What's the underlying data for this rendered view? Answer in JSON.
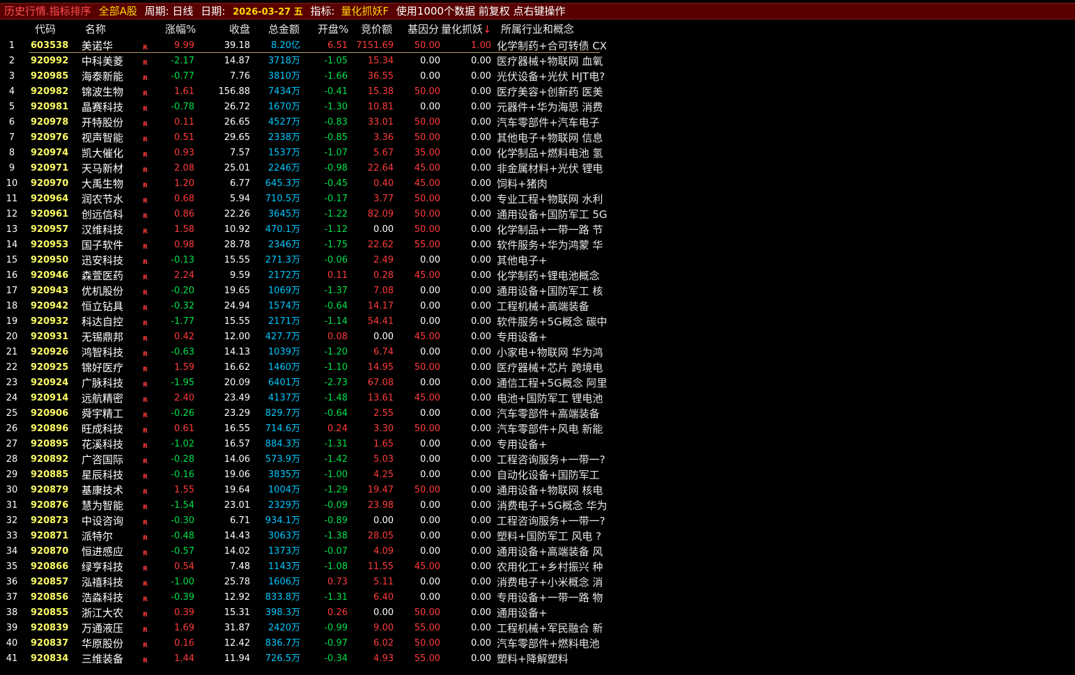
{
  "titlebar": {
    "module": "历史行情.指标排序",
    "scope": "全部A股",
    "period": "周期: 日线",
    "date_label": "日期:",
    "date": "2026-03-27 五",
    "indicator_label": "指标:",
    "indicator": "量化抓妖F",
    "info": "使用1000个数据 前复权 点右键操作"
  },
  "columns": {
    "code": "代码",
    "name": "名称",
    "chg": "涨幅%",
    "close": "收盘",
    "amount": "总金额",
    "open": "开盘%",
    "bid": "竞价额",
    "base": "基因分",
    "indicator": "量化抓妖",
    "sort_arrow": "↓",
    "concept": "所属行业和概念"
  },
  "colors": {
    "background": "#000000",
    "titlebar": "#590000",
    "up": "#ff3b3b",
    "down": "#00e04a",
    "code": "#ffff66",
    "amount": "#00c8ff"
  },
  "rows": [
    {
      "idx": "1",
      "code": "603538",
      "name": "美诺华",
      "r": "R",
      "chg": "9.99",
      "close": "39.18",
      "amount": "8.20亿",
      "open": "6.51",
      "bid": "7151.69",
      "base": "50.00",
      "ind": "1.00",
      "concept": "化学制药+合可转债 CX"
    },
    {
      "idx": "2",
      "code": "920992",
      "name": "中科美菱",
      "r": "R",
      "chg": "-2.17",
      "close": "14.87",
      "amount": "3718万",
      "open": "-1.05",
      "bid": "15.34",
      "base": "0.00",
      "ind": "0.00",
      "concept": "医疗器械+物联网 血氧"
    },
    {
      "idx": "3",
      "code": "920985",
      "name": "海泰新能",
      "r": "R",
      "chg": "-0.77",
      "close": "7.76",
      "amount": "3810万",
      "open": "-1.66",
      "bid": "36.55",
      "base": "0.00",
      "ind": "0.00",
      "concept": "光伏设备+光伏 HJT电?"
    },
    {
      "idx": "4",
      "code": "920982",
      "name": "锦波生物",
      "r": "R",
      "chg": "1.61",
      "close": "156.88",
      "amount": "7434万",
      "open": "-0.41",
      "bid": "15.38",
      "base": "50.00",
      "ind": "0.00",
      "concept": "医疗美容+创新药 医美"
    },
    {
      "idx": "5",
      "code": "920981",
      "name": "晶赛科技",
      "r": "R",
      "chg": "-0.78",
      "close": "26.72",
      "amount": "1670万",
      "open": "-1.30",
      "bid": "10.81",
      "base": "0.00",
      "ind": "0.00",
      "concept": "元器件+华为海思 消费"
    },
    {
      "idx": "6",
      "code": "920978",
      "name": "开特股份",
      "r": "R",
      "chg": "0.11",
      "close": "26.65",
      "amount": "4527万",
      "open": "-0.83",
      "bid": "33.01",
      "base": "50.00",
      "ind": "0.00",
      "concept": "汽车零部件+汽车电子"
    },
    {
      "idx": "7",
      "code": "920976",
      "name": "视声智能",
      "r": "R",
      "chg": "0.51",
      "close": "29.65",
      "amount": "2338万",
      "open": "-0.85",
      "bid": "3.36",
      "base": "50.00",
      "ind": "0.00",
      "concept": "其他电子+物联网 信息"
    },
    {
      "idx": "8",
      "code": "920974",
      "name": "凯大催化",
      "r": "R",
      "chg": "0.93",
      "close": "7.57",
      "amount": "1537万",
      "open": "-1.07",
      "bid": "5.67",
      "base": "35.00",
      "ind": "0.00",
      "concept": "化学制品+燃料电池 氢"
    },
    {
      "idx": "9",
      "code": "920971",
      "name": "天马新材",
      "r": "R",
      "chg": "2.08",
      "close": "25.01",
      "amount": "2246万",
      "open": "-0.98",
      "bid": "22.64",
      "base": "45.00",
      "ind": "0.00",
      "concept": "非金属材料+光伏 锂电"
    },
    {
      "idx": "10",
      "code": "920970",
      "name": "大禹生物",
      "r": "R",
      "chg": "1.20",
      "close": "6.77",
      "amount": "645.3万",
      "open": "-0.45",
      "bid": "0.40",
      "base": "45.00",
      "ind": "0.00",
      "concept": "饲料+猪肉"
    },
    {
      "idx": "11",
      "code": "920964",
      "name": "润农节水",
      "r": "R",
      "chg": "0.68",
      "close": "5.94",
      "amount": "710.5万",
      "open": "-0.17",
      "bid": "3.77",
      "base": "50.00",
      "ind": "0.00",
      "concept": "专业工程+物联网 水利"
    },
    {
      "idx": "12",
      "code": "920961",
      "name": "创远信科",
      "r": "R",
      "chg": "0.86",
      "close": "22.26",
      "amount": "3645万",
      "open": "-1.22",
      "bid": "82.09",
      "base": "50.00",
      "ind": "0.00",
      "concept": "通用设备+国防军工 5G"
    },
    {
      "idx": "13",
      "code": "920957",
      "name": "汉维科技",
      "r": "R",
      "chg": "1.58",
      "close": "10.92",
      "amount": "470.1万",
      "open": "-1.12",
      "bid": "0.00",
      "base": "50.00",
      "ind": "0.00",
      "concept": "化学制品+一带一路 节"
    },
    {
      "idx": "14",
      "code": "920953",
      "name": "国子软件",
      "r": "R",
      "chg": "0.98",
      "close": "28.78",
      "amount": "2346万",
      "open": "-1.75",
      "bid": "22.62",
      "base": "55.00",
      "ind": "0.00",
      "concept": "软件服务+华为鸿蒙 华"
    },
    {
      "idx": "15",
      "code": "920950",
      "name": "迅安科技",
      "r": "R",
      "chg": "-0.13",
      "close": "15.55",
      "amount": "271.3万",
      "open": "-0.06",
      "bid": "2.49",
      "base": "0.00",
      "ind": "0.00",
      "concept": "其他电子+"
    },
    {
      "idx": "16",
      "code": "920946",
      "name": "森萱医药",
      "r": "R",
      "chg": "2.24",
      "close": "9.59",
      "amount": "2172万",
      "open": "0.11",
      "bid": "0.28",
      "base": "45.00",
      "ind": "0.00",
      "concept": "化学制药+锂电池概念"
    },
    {
      "idx": "17",
      "code": "920943",
      "name": "优机股份",
      "r": "R",
      "chg": "-0.20",
      "close": "19.65",
      "amount": "1069万",
      "open": "-1.37",
      "bid": "7.08",
      "base": "0.00",
      "ind": "0.00",
      "concept": "通用设备+国防军工 核"
    },
    {
      "idx": "18",
      "code": "920942",
      "name": "恒立钻具",
      "r": "R",
      "chg": "-0.32",
      "close": "24.94",
      "amount": "1574万",
      "open": "-0.64",
      "bid": "14.17",
      "base": "0.00",
      "ind": "0.00",
      "concept": "工程机械+高端装备"
    },
    {
      "idx": "19",
      "code": "920932",
      "name": "科达自控",
      "r": "R",
      "chg": "-1.77",
      "close": "15.55",
      "amount": "2171万",
      "open": "-1.14",
      "bid": "54.41",
      "base": "0.00",
      "ind": "0.00",
      "concept": "软件服务+5G概念 碳中"
    },
    {
      "idx": "20",
      "code": "920931",
      "name": "无锡鼎邦",
      "r": "R",
      "chg": "0.42",
      "close": "12.00",
      "amount": "427.7万",
      "open": "0.08",
      "bid": "0.00",
      "base": "45.00",
      "ind": "0.00",
      "concept": "专用设备+"
    },
    {
      "idx": "21",
      "code": "920926",
      "name": "鸿智科技",
      "r": "R",
      "chg": "-0.63",
      "close": "14.13",
      "amount": "1039万",
      "open": "-1.20",
      "bid": "6.74",
      "base": "0.00",
      "ind": "0.00",
      "concept": "小家电+物联网 华为鸿"
    },
    {
      "idx": "22",
      "code": "920925",
      "name": "锦好医疗",
      "r": "R",
      "chg": "1.59",
      "close": "16.62",
      "amount": "1460万",
      "open": "-1.10",
      "bid": "14.95",
      "base": "50.00",
      "ind": "0.00",
      "concept": "医疗器械+芯片 跨境电"
    },
    {
      "idx": "23",
      "code": "920924",
      "name": "广脉科技",
      "r": "R",
      "chg": "-1.95",
      "close": "20.09",
      "amount": "6401万",
      "open": "-2.73",
      "bid": "67.08",
      "base": "0.00",
      "ind": "0.00",
      "concept": "通信工程+5G概念 阿里"
    },
    {
      "idx": "24",
      "code": "920914",
      "name": "远航精密",
      "r": "R",
      "chg": "2.40",
      "close": "23.49",
      "amount": "4137万",
      "open": "-1.48",
      "bid": "13.61",
      "base": "45.00",
      "ind": "0.00",
      "concept": "电池+国防军工 锂电池"
    },
    {
      "idx": "25",
      "code": "920906",
      "name": "舜宇精工",
      "r": "R",
      "chg": "-0.26",
      "close": "23.29",
      "amount": "829.7万",
      "open": "-0.64",
      "bid": "2.55",
      "base": "0.00",
      "ind": "0.00",
      "concept": "汽车零部件+高端装备"
    },
    {
      "idx": "26",
      "code": "920896",
      "name": "旺成科技",
      "r": "R",
      "chg": "0.61",
      "close": "16.55",
      "amount": "714.6万",
      "open": "0.24",
      "bid": "3.30",
      "base": "50.00",
      "ind": "0.00",
      "concept": "汽车零部件+风电 新能"
    },
    {
      "idx": "27",
      "code": "920895",
      "name": "花溪科技",
      "r": "R",
      "chg": "-1.02",
      "close": "16.57",
      "amount": "884.3万",
      "open": "-1.31",
      "bid": "1.65",
      "base": "0.00",
      "ind": "0.00",
      "concept": "专用设备+"
    },
    {
      "idx": "28",
      "code": "920892",
      "name": "广咨国际",
      "r": "R",
      "chg": "-0.28",
      "close": "14.06",
      "amount": "573.9万",
      "open": "-1.42",
      "bid": "5.03",
      "base": "0.00",
      "ind": "0.00",
      "concept": "工程咨询服务+一带一?"
    },
    {
      "idx": "29",
      "code": "920885",
      "name": "星辰科技",
      "r": "R",
      "chg": "-0.16",
      "close": "19.06",
      "amount": "3835万",
      "open": "-1.00",
      "bid": "4.25",
      "base": "0.00",
      "ind": "0.00",
      "concept": "自动化设备+国防军工"
    },
    {
      "idx": "30",
      "code": "920879",
      "name": "基康技术",
      "r": "R",
      "chg": "1.55",
      "close": "19.64",
      "amount": "1004万",
      "open": "-1.29",
      "bid": "19.47",
      "base": "50.00",
      "ind": "0.00",
      "concept": "通用设备+物联网 核电"
    },
    {
      "idx": "31",
      "code": "920876",
      "name": "慧为智能",
      "r": "R",
      "chg": "-1.54",
      "close": "23.01",
      "amount": "2329万",
      "open": "-0.09",
      "bid": "23.98",
      "base": "0.00",
      "ind": "0.00",
      "concept": "消费电子+5G概念 华为"
    },
    {
      "idx": "32",
      "code": "920873",
      "name": "中设咨询",
      "r": "R",
      "chg": "-0.30",
      "close": "6.71",
      "amount": "934.1万",
      "open": "-0.89",
      "bid": "0.00",
      "base": "0.00",
      "ind": "0.00",
      "concept": "工程咨询服务+一带一?"
    },
    {
      "idx": "33",
      "code": "920871",
      "name": "派特尔",
      "r": "R",
      "chg": "-0.48",
      "close": "14.43",
      "amount": "3063万",
      "open": "-1.38",
      "bid": "28.05",
      "base": "0.00",
      "ind": "0.00",
      "concept": "塑料+国防军工 风电 ?"
    },
    {
      "idx": "34",
      "code": "920870",
      "name": "恒进感应",
      "r": "R",
      "chg": "-0.57",
      "close": "14.02",
      "amount": "1373万",
      "open": "-0.07",
      "bid": "4.09",
      "base": "0.00",
      "ind": "0.00",
      "concept": "通用设备+高端装备 风"
    },
    {
      "idx": "35",
      "code": "920866",
      "name": "绿亨科技",
      "r": "R",
      "chg": "0.54",
      "close": "7.48",
      "amount": "1143万",
      "open": "-1.08",
      "bid": "11.55",
      "base": "45.00",
      "ind": "0.00",
      "concept": "农用化工+乡村振兴 种"
    },
    {
      "idx": "36",
      "code": "920857",
      "name": "泓禧科技",
      "r": "R",
      "chg": "-1.00",
      "close": "25.78",
      "amount": "1606万",
      "open": "0.73",
      "bid": "5.11",
      "base": "0.00",
      "ind": "0.00",
      "concept": "消费电子+小米概念 消"
    },
    {
      "idx": "37",
      "code": "920856",
      "name": "浩淼科技",
      "r": "R",
      "chg": "-0.39",
      "close": "12.92",
      "amount": "833.8万",
      "open": "-1.31",
      "bid": "6.40",
      "base": "0.00",
      "ind": "0.00",
      "concept": "专用设备+一带一路 物"
    },
    {
      "idx": "38",
      "code": "920855",
      "name": "浙江大农",
      "r": "R",
      "chg": "0.39",
      "close": "15.31",
      "amount": "398.3万",
      "open": "0.26",
      "bid": "0.00",
      "base": "50.00",
      "ind": "0.00",
      "concept": "通用设备+"
    },
    {
      "idx": "39",
      "code": "920839",
      "name": "万通液压",
      "r": "R",
      "chg": "1.69",
      "close": "31.87",
      "amount": "2420万",
      "open": "-0.99",
      "bid": "9.00",
      "base": "55.00",
      "ind": "0.00",
      "concept": "工程机械+军民融合 新"
    },
    {
      "idx": "40",
      "code": "920837",
      "name": "华原股份",
      "r": "R",
      "chg": "0.16",
      "close": "12.42",
      "amount": "836.7万",
      "open": "-0.97",
      "bid": "6.02",
      "base": "50.00",
      "ind": "0.00",
      "concept": "汽车零部件+燃料电池"
    },
    {
      "idx": "41",
      "code": "920834",
      "name": "三维装备",
      "r": "R",
      "chg": "1.44",
      "close": "11.94",
      "amount": "726.5万",
      "open": "-0.34",
      "bid": "4.93",
      "base": "55.00",
      "ind": "0.00",
      "concept": "塑料+降解塑料"
    }
  ]
}
